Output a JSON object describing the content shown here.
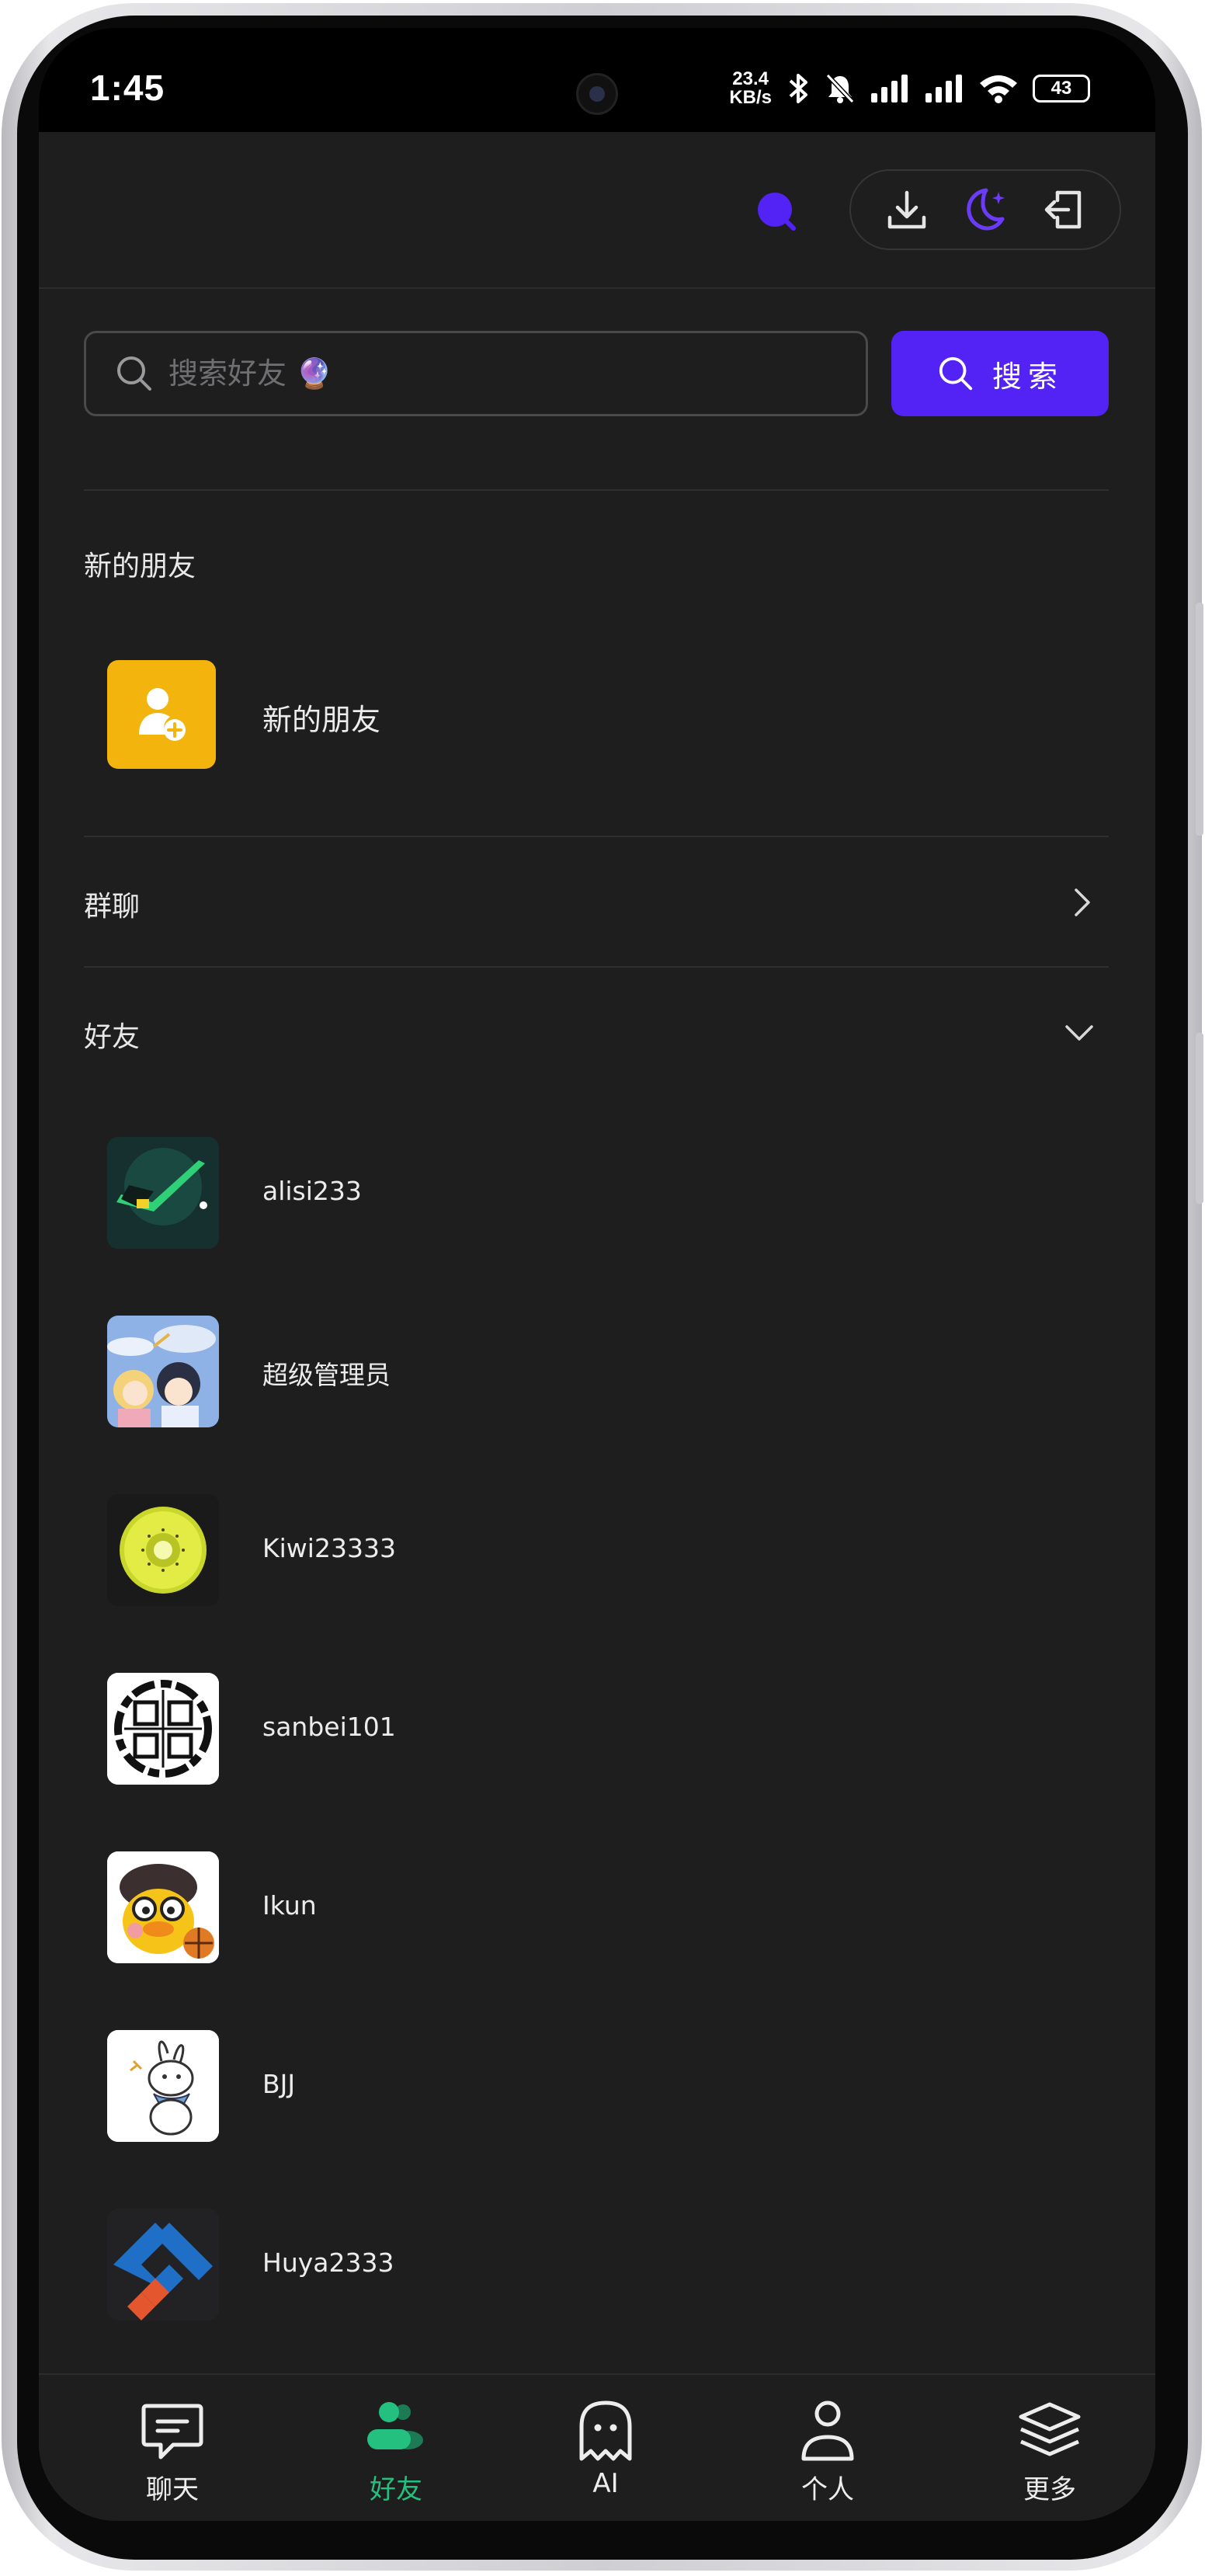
{
  "status_bar": {
    "time": "1:45",
    "speed_value": "23.4",
    "speed_unit": "KB/s",
    "battery": "43",
    "icons": [
      "camera-icon",
      "bluetooth-icon",
      "mute-bell-icon",
      "signal-icon",
      "signal-icon",
      "wifi-icon",
      "battery-icon"
    ]
  },
  "toolbar": {
    "icons": [
      "search-blob-icon",
      "download-icon",
      "dark-mode-moon-icon",
      "logout-icon"
    ],
    "accent": "#5322f5"
  },
  "search": {
    "placeholder": "搜索好友 🔮",
    "value": "",
    "button_label": "搜索"
  },
  "sections": {
    "new_friends": {
      "title": "新的朋友",
      "item_label": "新的朋友",
      "item_color": "#f3b40e"
    },
    "groups": {
      "title": "群聊",
      "state": "collapsed"
    },
    "friends": {
      "title": "好友",
      "state": "expanded",
      "items": [
        {
          "name": "alisi233",
          "avatar": "green-arrow-avatar"
        },
        {
          "name": "超级管理员",
          "avatar": "anime-couple-avatar"
        },
        {
          "name": "Kiwi23333",
          "avatar": "kiwi-fruit-avatar"
        },
        {
          "name": "sanbei101",
          "avatar": "chinese-seal-avatar"
        },
        {
          "name": "Ikun",
          "avatar": "duck-basketball-avatar"
        },
        {
          "name": "BJJ",
          "avatar": "bunny-sketch-avatar"
        },
        {
          "name": "Huya2333",
          "avatar": "blue-logo-avatar"
        }
      ]
    }
  },
  "nav": {
    "active": "friends",
    "active_color": "#23c07f",
    "items": [
      {
        "label": "聊天",
        "icon": "chat-bubble-icon"
      },
      {
        "label": "好友",
        "icon": "friends-icon"
      },
      {
        "label": "AI",
        "icon": "ghost-icon"
      },
      {
        "label": "个人",
        "icon": "person-icon"
      },
      {
        "label": "更多",
        "icon": "layers-icon"
      }
    ]
  }
}
